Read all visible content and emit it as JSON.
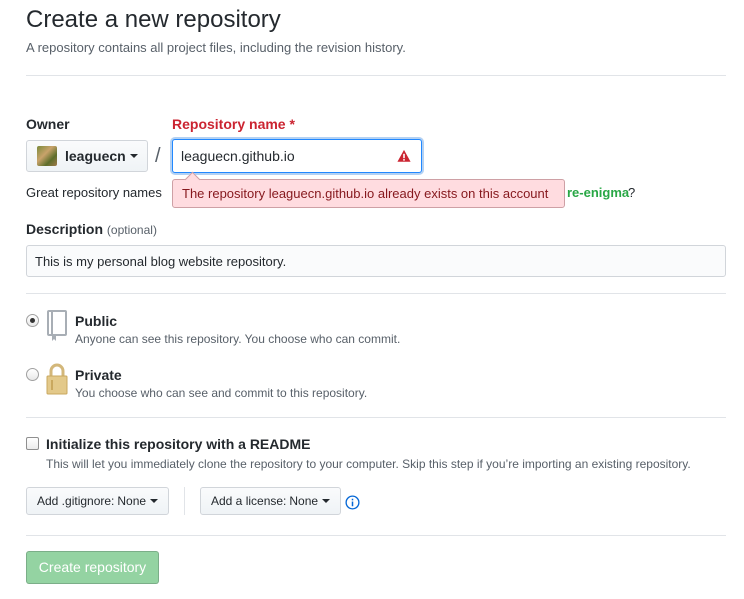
{
  "header": {
    "title": "Create a new repository",
    "subtitle": "A repository contains all project files, including the revision history."
  },
  "owner": {
    "label": "Owner",
    "value": "leaguecn"
  },
  "repo_name": {
    "label": "Repository name",
    "required_marker": "*",
    "value": "leaguecn.github.io",
    "error": "The repository leaguecn.github.io already exists on this account"
  },
  "slash": "/",
  "hint": {
    "text": "Great repository names",
    "suggestion": "re-enigma",
    "suffix": "?"
  },
  "description": {
    "label": "Description",
    "optional": "(optional)",
    "value": "This is my personal blog website repository."
  },
  "visibility": {
    "public": {
      "title": "Public",
      "desc": "Anyone can see this repository. You choose who can commit.",
      "selected": true
    },
    "private": {
      "title": "Private",
      "desc": "You choose who can see and commit to this repository.",
      "selected": false
    }
  },
  "readme": {
    "title": "Initialize this repository with a README",
    "desc": "This will let you immediately clone the repository to your computer. Skip this step if you’re importing an existing repository.",
    "checked": false
  },
  "gitignore": {
    "label": "Add .gitignore:",
    "value": "None"
  },
  "license": {
    "label": "Add a license:",
    "value": "None"
  },
  "submit": {
    "label": "Create repository"
  },
  "colors": {
    "error": "#cb2431",
    "error_bg": "#ffdce0",
    "suggestion": "#28a745",
    "create_button": "#94d3a2",
    "focus": "#2188ff"
  }
}
